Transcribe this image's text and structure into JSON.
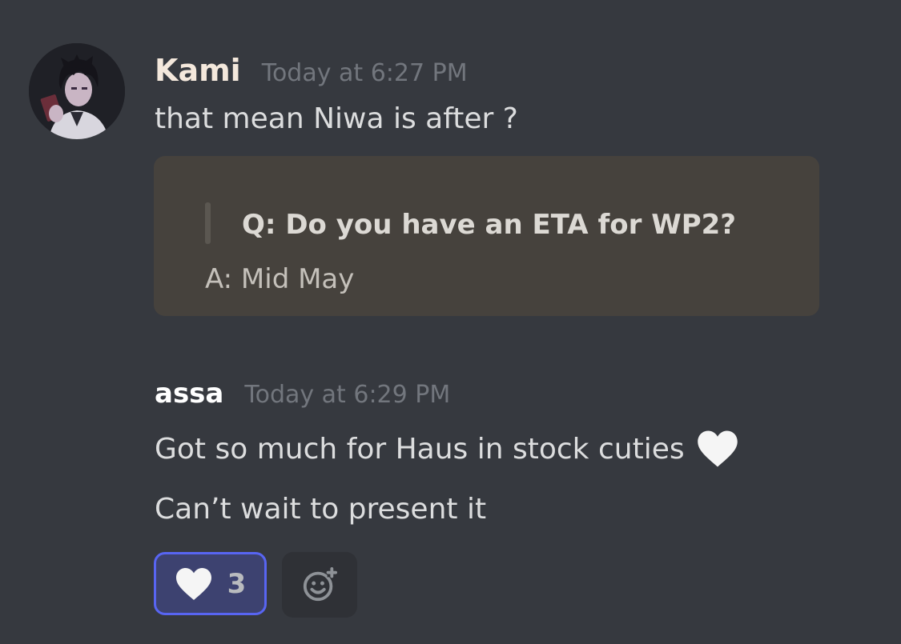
{
  "messages": [
    {
      "author": "Kami",
      "timestamp": "Today at 6:27 PM",
      "lines": [
        "that mean Niwa is after ?"
      ],
      "embed": {
        "question": "Q: Do you have an ETA for WP2?",
        "answer": "A: Mid May"
      }
    },
    {
      "author": "assa",
      "timestamp": "Today at 6:29 PM",
      "lines": [
        "Got so much for Haus in stock cuties",
        "Can’t wait to present it"
      ],
      "reactions": [
        {
          "emoji": "white-heart-icon",
          "count": "3",
          "selected": true
        }
      ]
    }
  ],
  "colors": {
    "background": "#36393f",
    "embed_background": "#46423d",
    "reaction_selected_border": "#5865f2",
    "timestamp": "#72767d"
  }
}
